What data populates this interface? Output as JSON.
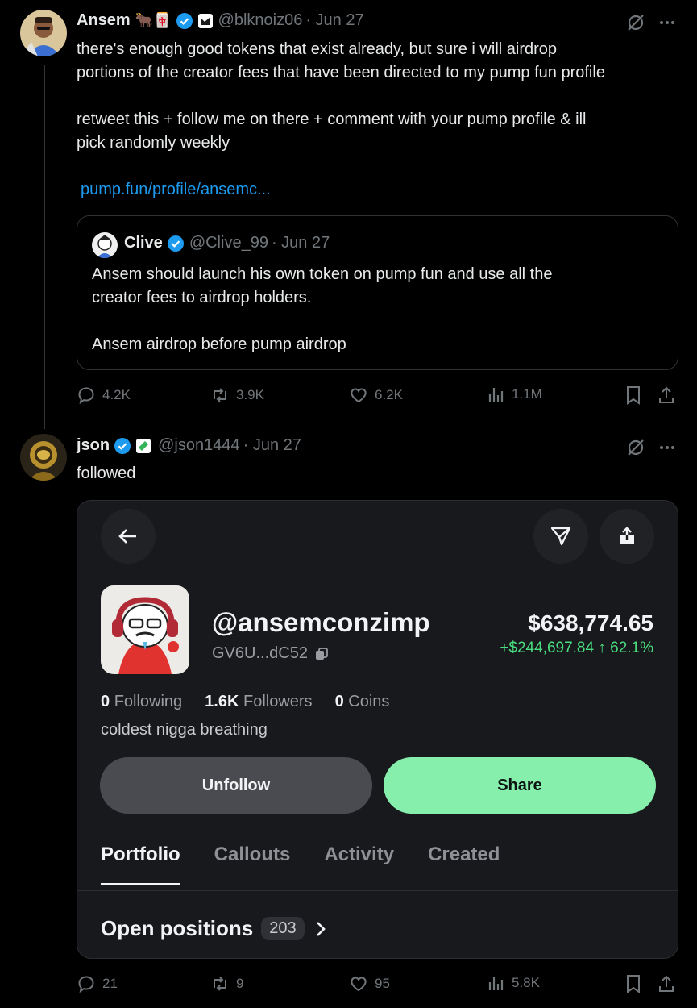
{
  "tweet1": {
    "name": "Ansem",
    "emoji": "🐂🀄",
    "handle": "@blknoiz06",
    "date": "· Jun 27",
    "line1": "there's enough good tokens that exist already, but sure i will airdrop",
    "line2": "portions of the creator fees that have been directed to my pump fun profile",
    "line3": "retweet this + follow me on there + comment with your pump profile & ill",
    "line4": "pick randomly weekly",
    "link": "pump.fun/profile/ansemc...",
    "quote": {
      "name": "Clive",
      "handle": "@Clive_99",
      "date": "· Jun 27",
      "line1": "Ansem should launch his own token on pump fun and use all the",
      "line2": "creator fees to airdrop holders.",
      "line3": "Ansem airdrop before pump airdrop"
    },
    "actions": {
      "replies": "4.2K",
      "reposts": "3.9K",
      "likes": "6.2K",
      "views": "1.1M"
    }
  },
  "tweet2": {
    "name": "json",
    "handle": "@json1444",
    "date": "· Jun 27",
    "text": "followed",
    "actions": {
      "replies": "21",
      "reposts": "9",
      "likes": "95",
      "views": "5.8K"
    }
  },
  "profile_card": {
    "handle": "@ansemconzimp",
    "address": "GV6U...dC52",
    "balance": "$638,774.65",
    "change": "+$244,697.84 ↑ 62.1%",
    "following_count": "0",
    "following_label": "Following",
    "followers_count": "1.6K",
    "followers_label": "Followers",
    "coins_count": "0",
    "coins_label": "Coins",
    "bio": "coldest nigga breathing",
    "unfollow_label": "Unfollow",
    "share_label": "Share",
    "tabs": [
      "Portfolio",
      "Callouts",
      "Activity",
      "Created"
    ],
    "positions_label": "Open positions",
    "positions_count": "203"
  },
  "colors": {
    "accent": "#1d9bf0",
    "positive": "#4ade80",
    "share": "#86efac"
  }
}
